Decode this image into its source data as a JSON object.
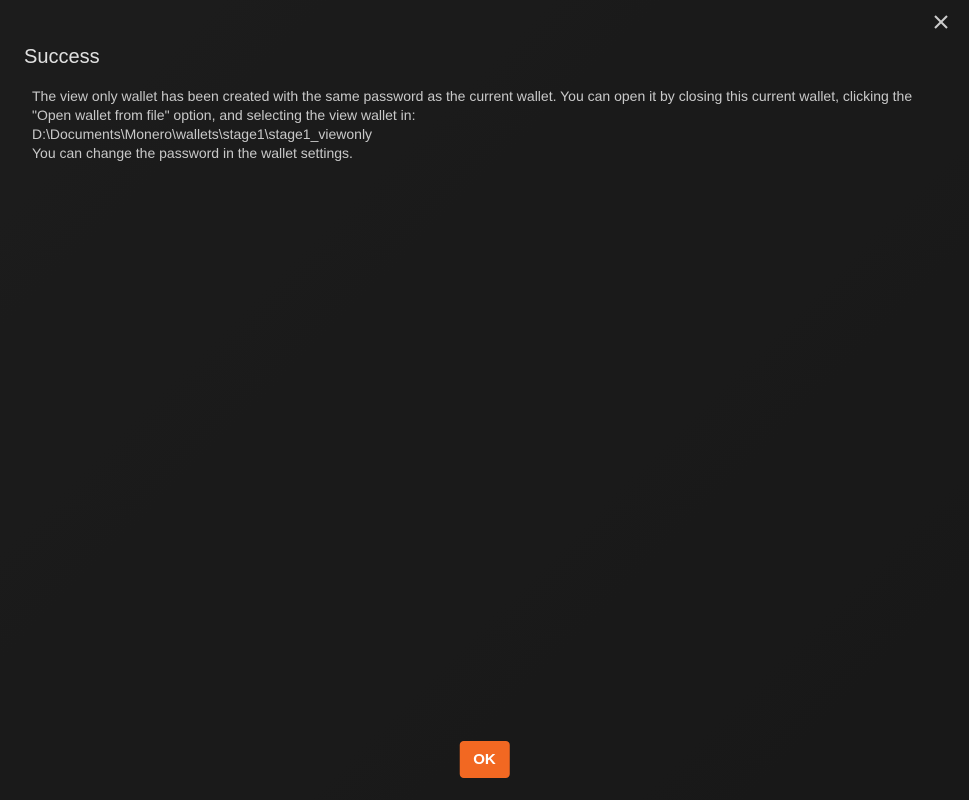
{
  "dialog": {
    "title": "Success",
    "message_line1": "The view only wallet has been created with the same password as the current wallet. You can open it by closing this current wallet, clicking the \"Open wallet from file\" option, and selecting the view wallet in:",
    "message_line2": "D:\\Documents\\Monero\\wallets\\stage1\\stage1_viewonly",
    "message_line3": "You can change the password in the wallet settings.",
    "ok_label": "OK"
  },
  "colors": {
    "accent": "#f26822",
    "background": "#1a1a1a",
    "text": "#c8c8c8"
  }
}
